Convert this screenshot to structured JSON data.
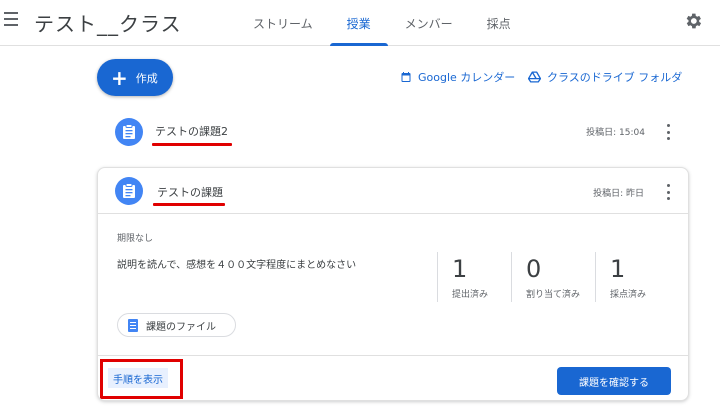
{
  "header": {
    "class_title": "テスト__クラス",
    "tabs": [
      {
        "label": "ストリーム"
      },
      {
        "label": "授業"
      },
      {
        "label": "メンバー"
      },
      {
        "label": "採点"
      }
    ],
    "active_tab": "授業"
  },
  "toolbar": {
    "create_label": "作成",
    "calendar_label": "Google カレンダー",
    "drive_label": "クラスのドライブ フォルダ"
  },
  "assignments": [
    {
      "title": "テストの課題2",
      "date": "投稿日: 15:04"
    },
    {
      "title": "テストの課題",
      "date": "投稿日: 昨日"
    }
  ],
  "detail": {
    "due": "期限なし",
    "description": "説明を読んで、感想を４００文字程度にまとめなさい",
    "stats": [
      {
        "value": "1",
        "label": "提出済み"
      },
      {
        "value": "0",
        "label": "割り当て済み"
      },
      {
        "value": "1",
        "label": "採点済み"
      }
    ],
    "file_label": "課題のファイル",
    "steps_label": "手順を表示",
    "review_label": "課題を確認する"
  },
  "colors": {
    "accent": "#1967d2",
    "icon_blue": "#4285f4",
    "highlight_red": "#e00000"
  }
}
